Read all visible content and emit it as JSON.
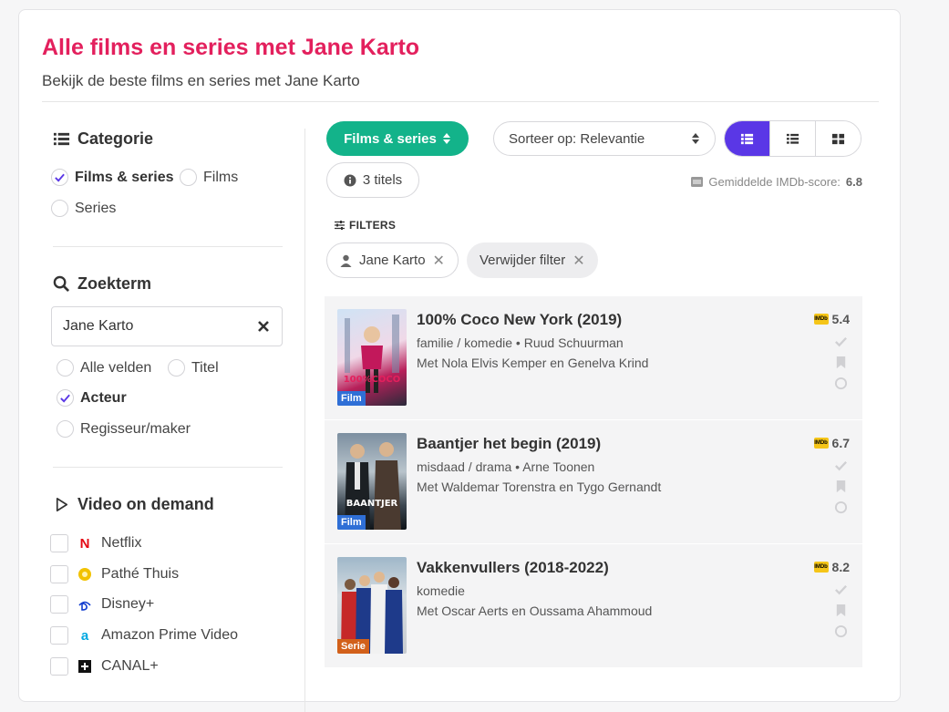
{
  "header": {
    "title": "Alle films en series met Jane Karto",
    "subtitle": "Bekijk de beste films en series met Jane Karto"
  },
  "sidebar": {
    "categorie": {
      "heading": "Categorie",
      "options": [
        {
          "label": "Films & series",
          "selected": true
        },
        {
          "label": "Films",
          "selected": false
        },
        {
          "label": "Series",
          "selected": false
        }
      ]
    },
    "zoekterm": {
      "heading": "Zoekterm",
      "value": "Jane Karto",
      "options": [
        {
          "label": "Alle velden",
          "selected": false
        },
        {
          "label": "Titel",
          "selected": false
        },
        {
          "label": "Acteur",
          "selected": true
        },
        {
          "label": "Regisseur/maker",
          "selected": false
        }
      ]
    },
    "vod": {
      "heading": "Video on demand",
      "services": [
        {
          "label": "Netflix",
          "color": "#e50914"
        },
        {
          "label": "Pathé Thuis",
          "color": "#f2c200"
        },
        {
          "label": "Disney+",
          "color": "#113ccf"
        },
        {
          "label": "Amazon Prime Video",
          "color": "#00a8e1"
        },
        {
          "label": "CANAL+",
          "color": "#111111"
        }
      ]
    }
  },
  "toolbar": {
    "type_label": "Films & series",
    "sort_label": "Sorteer op: Relevantie",
    "count_label": "3 titels",
    "imdb_avg_label": "Gemiddelde IMDb-score:",
    "imdb_avg_value": "6.8",
    "filters_label": "FILTERS",
    "chip_actor": "Jane Karto",
    "chip_remove": "Verwijder filter"
  },
  "results": [
    {
      "title": "100% Coco New York (2019)",
      "genre": "familie / komedie",
      "director": "Ruud Schuurman",
      "cast": "Met Nola Elvis Kemper en Genelva Krind",
      "imdb": "5.4",
      "badge": "Film",
      "badge_color": "#2f6fd6"
    },
    {
      "title": "Baantjer het begin (2019)",
      "genre": "misdaad / drama",
      "director": "Arne Toonen",
      "cast": "Met Waldemar Torenstra en Tygo Gernandt",
      "imdb": "6.7",
      "badge": "Film",
      "badge_color": "#2f6fd6"
    },
    {
      "title": "Vakkenvullers (2018-2022)",
      "genre": "komedie",
      "director": "",
      "cast": "Met Oscar Aerts en Oussama Ahammoud",
      "imdb": "8.2",
      "badge": "Serie",
      "badge_color": "#d2601a"
    }
  ],
  "colors": {
    "accent_title": "#e3205d",
    "button_green": "#13b38a",
    "view_active": "#5a37e6",
    "check_purple": "#5a37e6"
  }
}
